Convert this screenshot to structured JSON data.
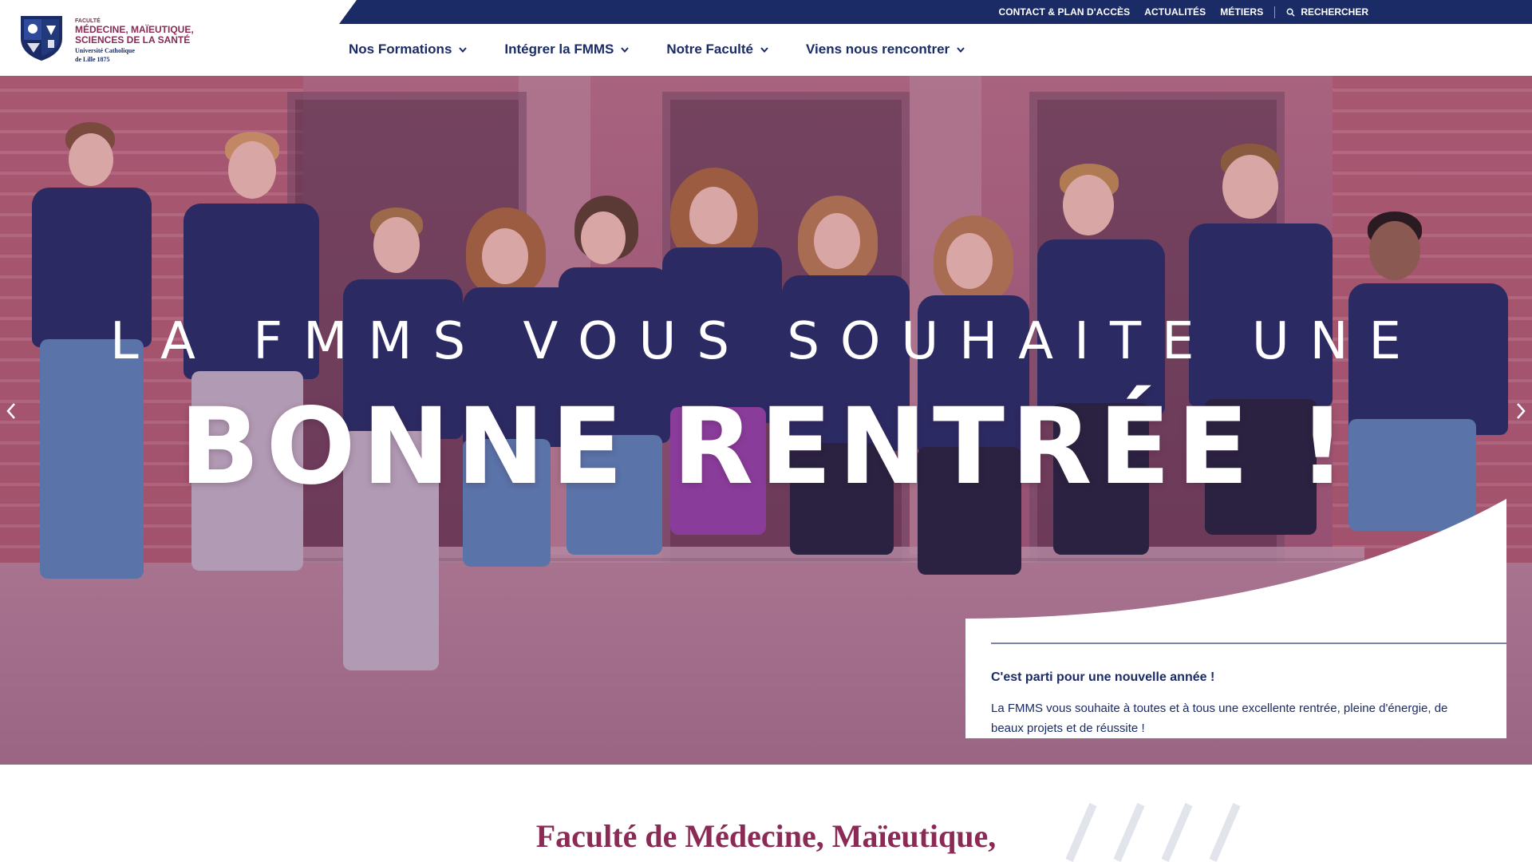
{
  "header": {
    "logo": {
      "line_small": "FACULTÉ",
      "line1": "MÉDECINE, MAÏEUTIQUE,",
      "line2": "SCIENCES DE LA SANTÉ",
      "line3": "Université Catholique",
      "line4": "de Lille 1875"
    },
    "topbar": {
      "links": [
        "CONTACT & PLAN D'ACCÈS",
        "ACTUALITÉS",
        "MÉTIERS"
      ],
      "search_label": "RECHERCHER"
    },
    "nav": [
      {
        "label": "Nos Formations"
      },
      {
        "label": "Intégrer la FMMS"
      },
      {
        "label": "Notre Faculté"
      },
      {
        "label": "Viens nous rencontrer"
      }
    ]
  },
  "hero": {
    "line1": "LA FMMS VOUS SOUHAITE UNE",
    "line2": "BONNE RENTRÉE !",
    "card": {
      "title": "C'est parti pour une nouvelle année !",
      "text": "La FMMS vous souhaite à toutes et à tous une excellente rentrée, pleine d'énergie, de beaux projets et de réussite !"
    }
  },
  "below": {
    "heading": "Faculté de Médecine, Maïeutique,"
  },
  "colors": {
    "navy": "#1b2b66",
    "brand_plum": "#8a2a55",
    "hero_overlay": "#9a5475"
  },
  "icons": [
    "search-icon",
    "chevron-down-icon",
    "arrow-left-icon",
    "arrow-right-icon",
    "crest-logo-icon"
  ]
}
